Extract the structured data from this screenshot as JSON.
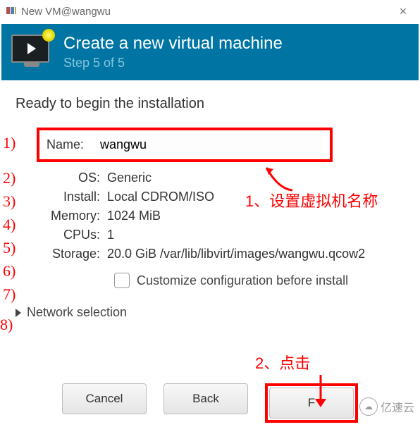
{
  "window": {
    "title": "New VM@wangwu"
  },
  "banner": {
    "title": "Create a new virtual machine",
    "step": "Step 5 of 5"
  },
  "form": {
    "ready": "Ready to begin the installation",
    "name_label": "Name:",
    "name_value": "wangwu",
    "rows": [
      {
        "label": "OS:",
        "value": "Generic"
      },
      {
        "label": "Install:",
        "value": "Local CDROM/ISO"
      },
      {
        "label": "Memory:",
        "value": "1024 MiB"
      },
      {
        "label": "CPUs:",
        "value": "1"
      },
      {
        "label": "Storage:",
        "value": "20.0 GiB /var/lib/libvirt/images/wangwu.qcow2"
      }
    ],
    "customize_label": "Customize configuration before install",
    "network_label": "Network selection"
  },
  "buttons": {
    "cancel": "Cancel",
    "back": "Back",
    "finish": "F"
  },
  "annotations": {
    "nums": [
      "1)",
      "2)",
      "3)",
      "4)",
      "5)",
      "6)",
      "7)",
      "8)"
    ],
    "text1": "1、设置虚拟机名称",
    "text2": "2、点击"
  },
  "watermark": {
    "icon": "☁",
    "text": "亿速云"
  }
}
